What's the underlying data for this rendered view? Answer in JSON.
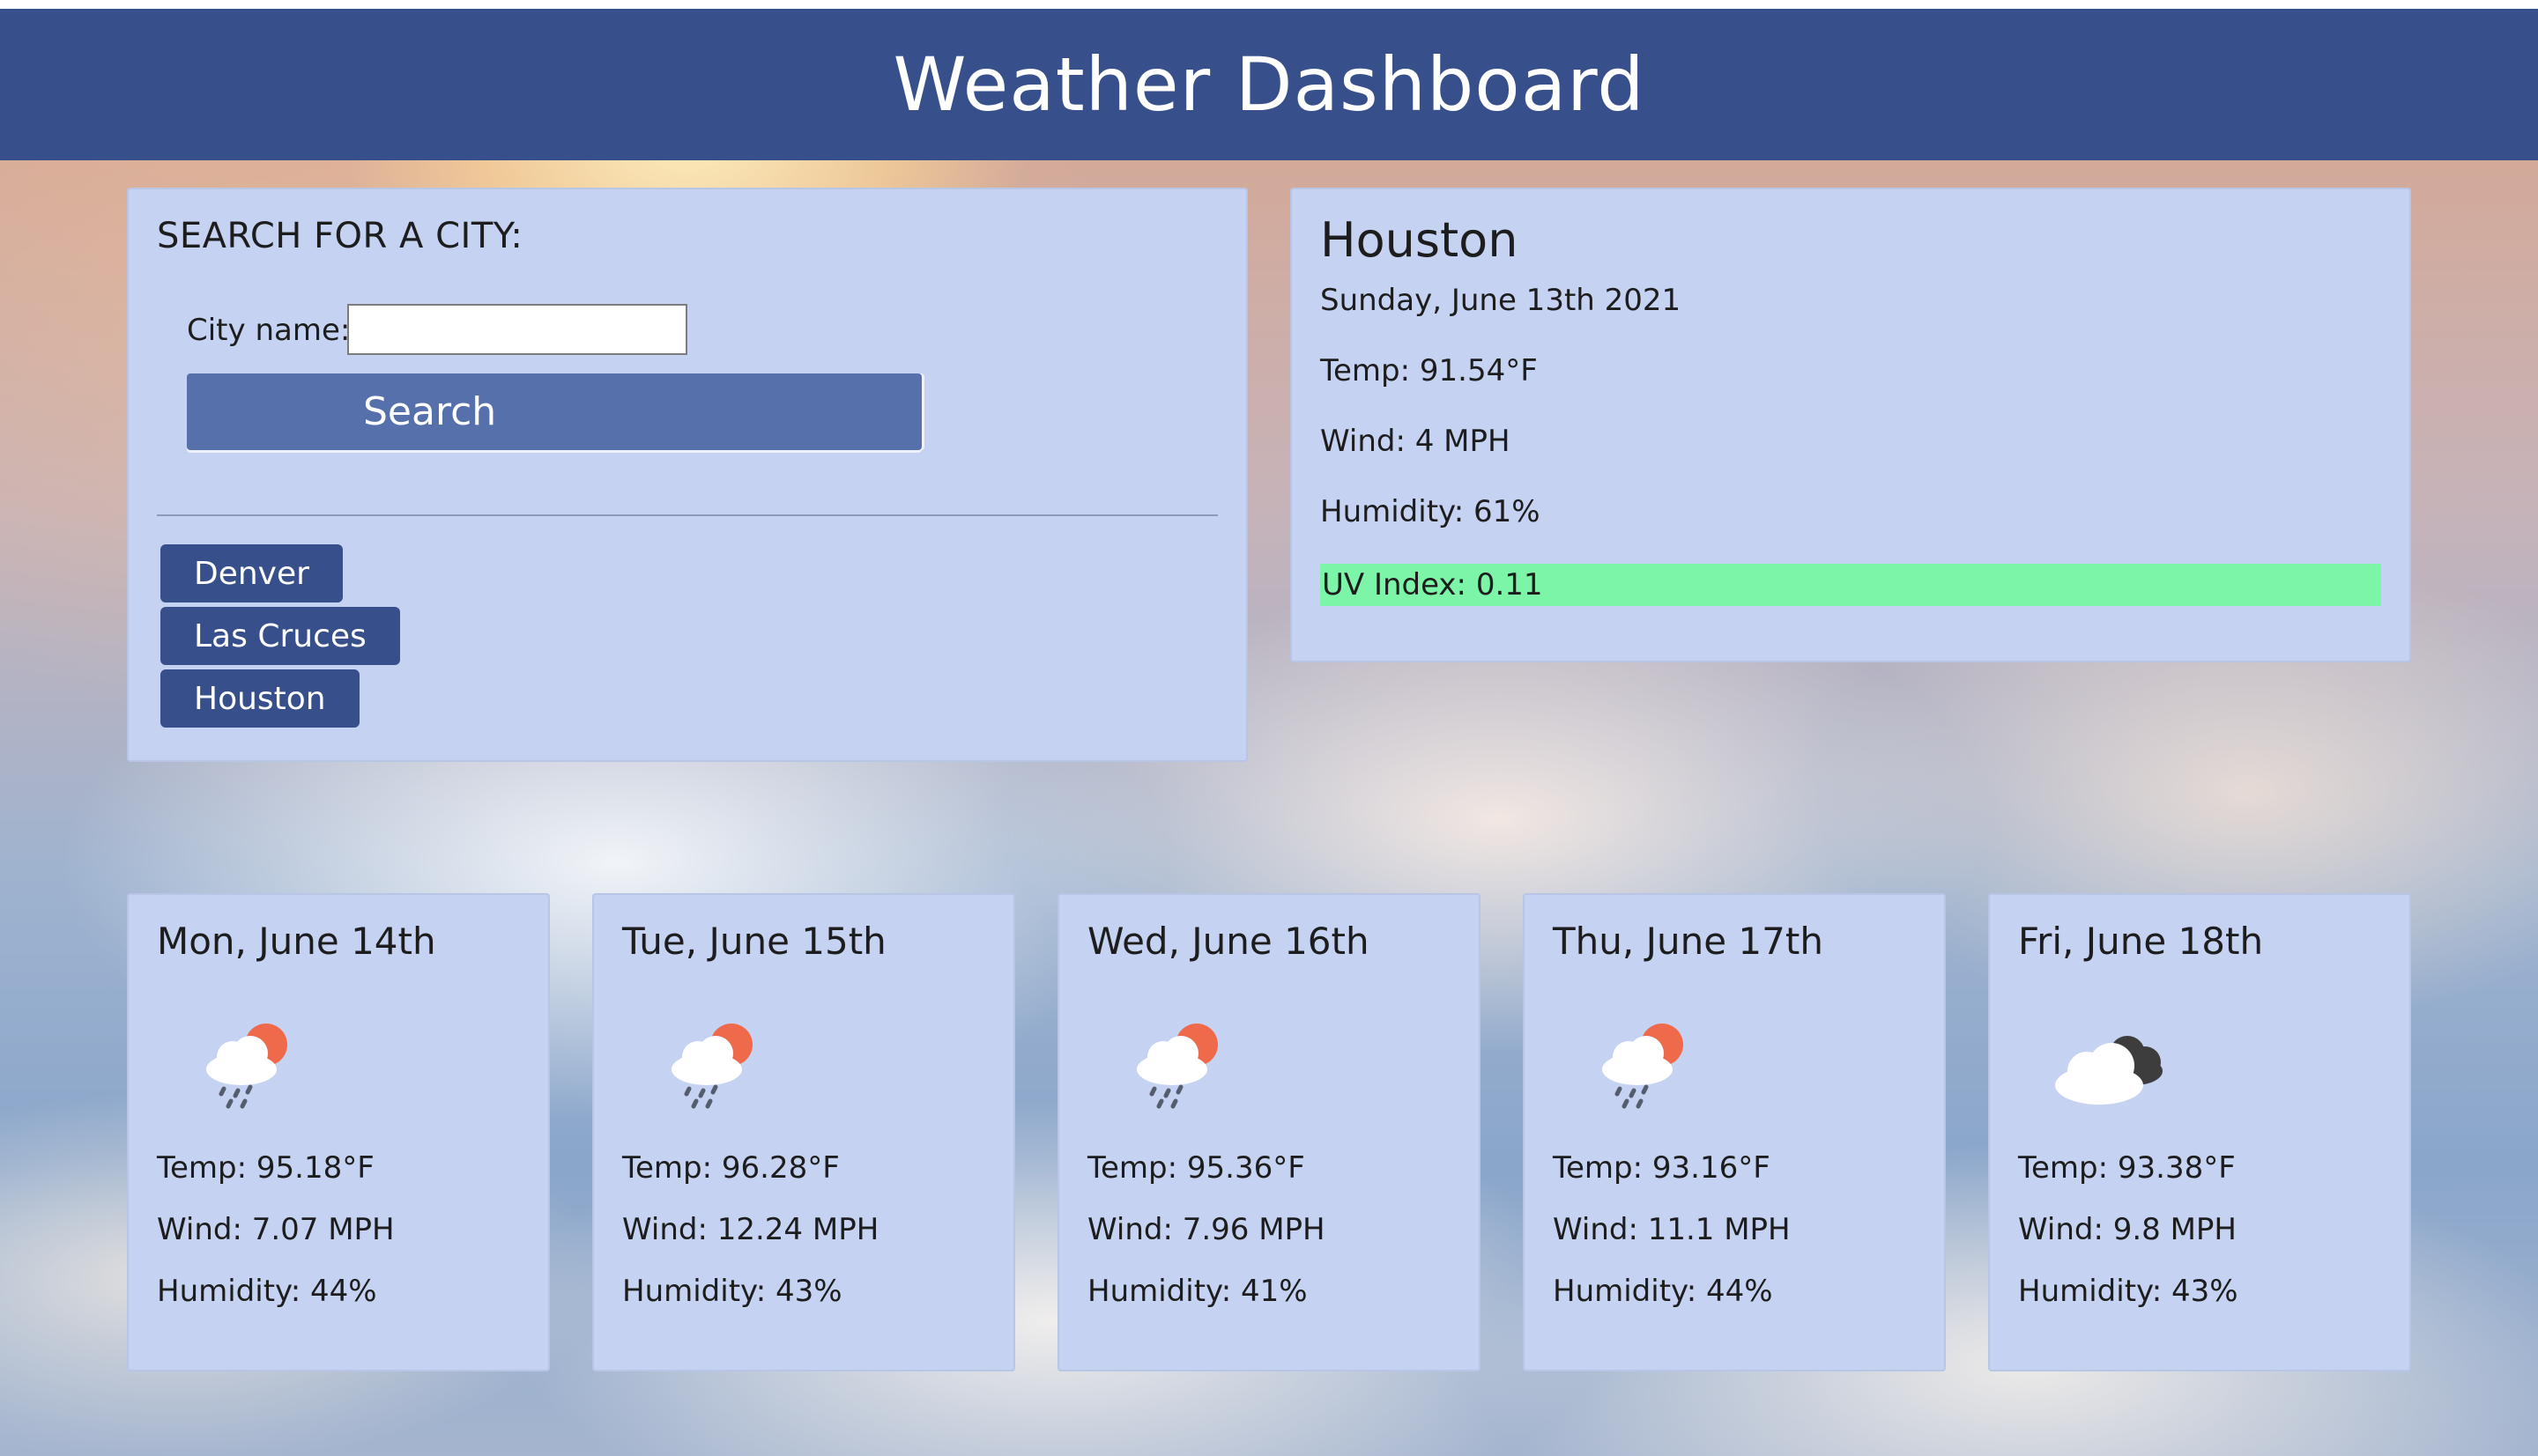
{
  "header": {
    "title": "Weather Dashboard"
  },
  "search": {
    "heading": "SEARCH FOR A CITY:",
    "city_label": "City name:",
    "input_value": "",
    "button_label": "Search",
    "history": [
      "Denver",
      "Las Cruces",
      "Houston"
    ]
  },
  "current": {
    "city": "Houston",
    "date": "Sunday, June 13th 2021",
    "temp": "Temp: 91.54°F",
    "wind": "Wind: 4 MPH",
    "humidity": "Humidity: 61%",
    "uv": "UV Index: 0.11",
    "uv_color": "#7cf5a8"
  },
  "forecast": [
    {
      "date": "Mon, June 14th",
      "icon": "rain-sun-icon",
      "temp": "Temp: 95.18°F",
      "wind": "Wind: 7.07 MPH",
      "humidity": "Humidity: 44%"
    },
    {
      "date": "Tue, June 15th",
      "icon": "rain-sun-icon",
      "temp": "Temp: 96.28°F",
      "wind": "Wind: 12.24 MPH",
      "humidity": "Humidity: 43%"
    },
    {
      "date": "Wed, June 16th",
      "icon": "rain-sun-icon",
      "temp": "Temp: 95.36°F",
      "wind": "Wind: 7.96 MPH",
      "humidity": "Humidity: 41%"
    },
    {
      "date": "Thu, June 17th",
      "icon": "rain-sun-icon",
      "temp": "Temp: 93.16°F",
      "wind": "Wind: 11.1 MPH",
      "humidity": "Humidity: 44%"
    },
    {
      "date": "Fri, June 18th",
      "icon": "cloudy-icon",
      "temp": "Temp: 93.38°F",
      "wind": "Wind: 9.8 MPH",
      "humidity": "Humidity: 43%"
    }
  ],
  "colors": {
    "header_bg": "#374f8b",
    "panel_bg": "#c5d2f1",
    "search_button": "#5670ab",
    "history_button": "#374f8b"
  }
}
